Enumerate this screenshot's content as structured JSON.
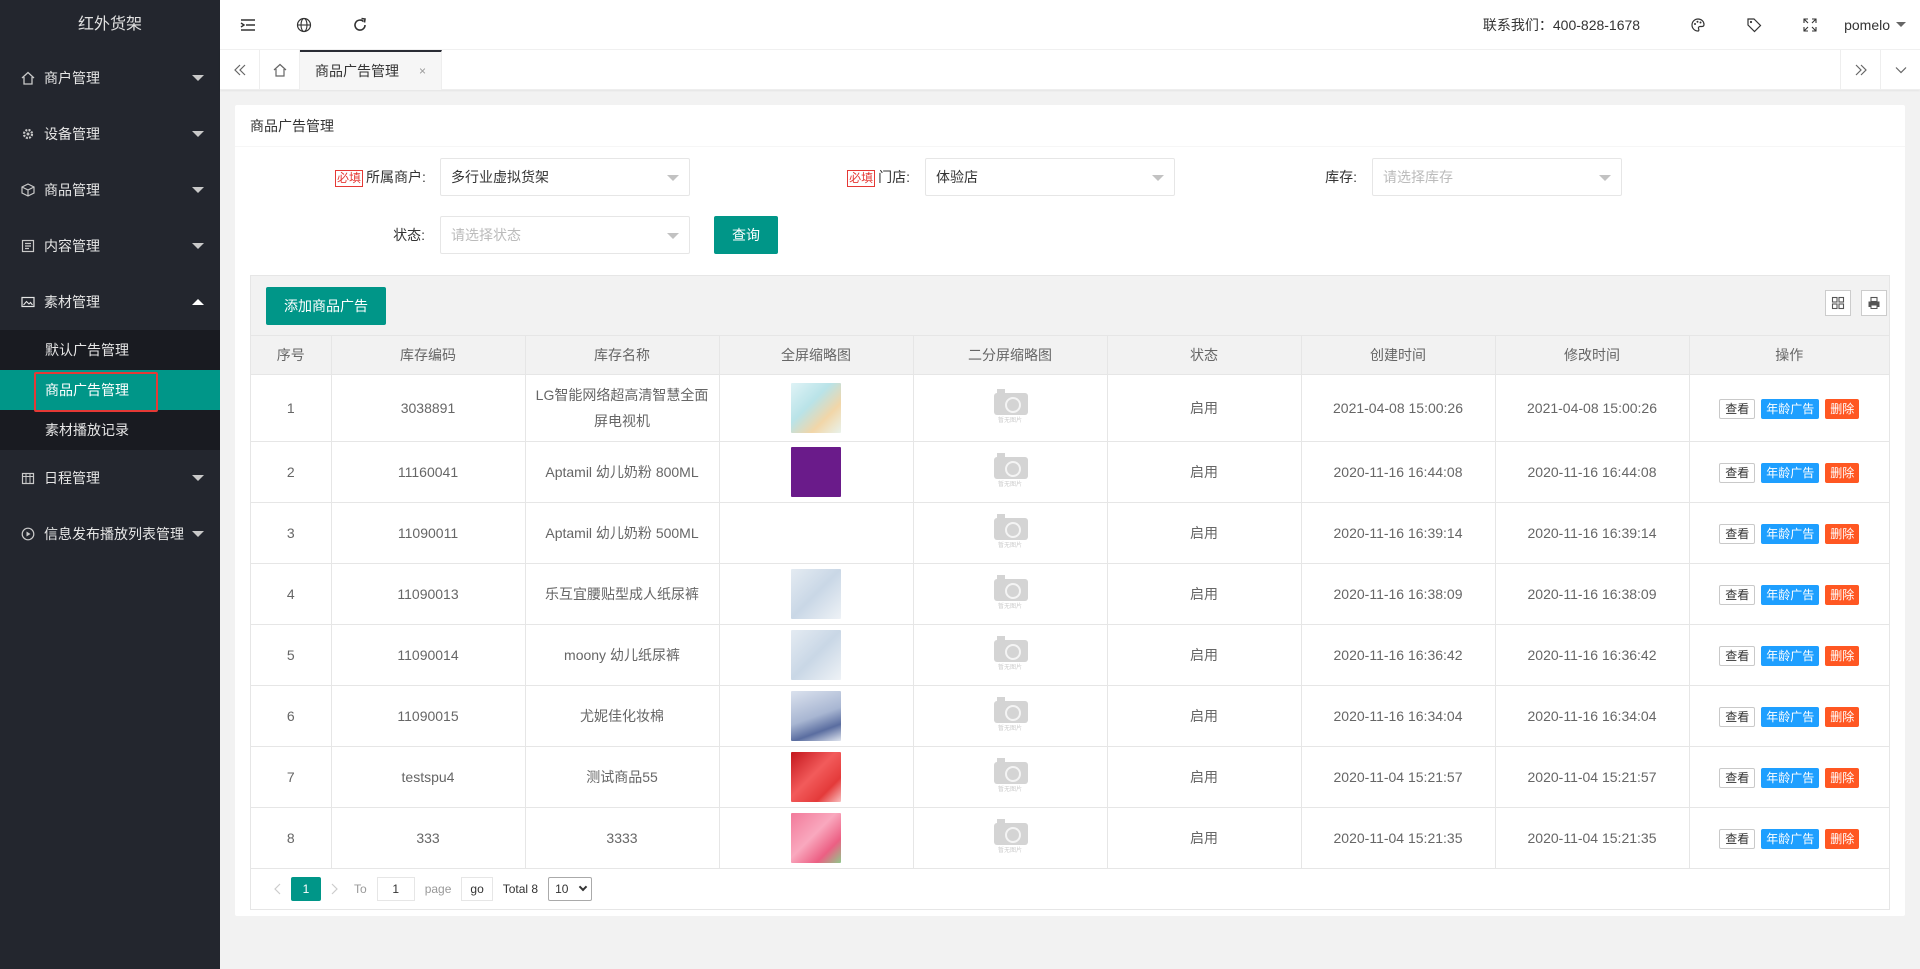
{
  "app": {
    "title": "红外货架"
  },
  "sidebar": {
    "items": [
      {
        "label": "商户管理",
        "icon": "home-icon"
      },
      {
        "label": "设备管理",
        "icon": "gear-icon"
      },
      {
        "label": "商品管理",
        "icon": "cube-icon"
      },
      {
        "label": "内容管理",
        "icon": "content-icon"
      },
      {
        "label": "素材管理",
        "icon": "image-icon",
        "open": true,
        "children": [
          {
            "label": "默认广告管理"
          },
          {
            "label": "商品广告管理",
            "active": true
          },
          {
            "label": "素材播放记录"
          }
        ]
      },
      {
        "label": "日程管理",
        "icon": "calendar-icon"
      },
      {
        "label": "信息发布播放列表管理",
        "icon": "play-icon"
      }
    ]
  },
  "header": {
    "contact": "联系我们：400-828-1678",
    "user": "pomelo"
  },
  "tabs": {
    "active_tab": "商品广告管理",
    "close_glyph": "×"
  },
  "card": {
    "title": "商品广告管理",
    "required_badge": "必填",
    "filters": {
      "merchant": {
        "label": "所属商户:",
        "value": "多行业虚拟货架"
      },
      "store": {
        "label": "门店:",
        "value": "体验店"
      },
      "stock": {
        "label": "库存:",
        "placeholder": "请选择库存"
      },
      "status": {
        "label": "状态:",
        "placeholder": "请选择状态"
      },
      "query_button": "查询"
    },
    "add_button": "添加商品广告",
    "table": {
      "columns": [
        "序号",
        "库存编码",
        "库存名称",
        "全屏缩略图",
        "二分屏缩略图",
        "状态",
        "创建时间",
        "修改时间",
        "操作"
      ],
      "placeholder_text": "暂无图片",
      "actions": {
        "view": "查看",
        "age": "年龄广告",
        "delete": "删除"
      },
      "rows": [
        {
          "no": "1",
          "code": "3038891",
          "name": "LG智能网络超高清智慧全面屏电视机",
          "thumb": "light-green",
          "status": "启用",
          "created": "2021-04-08 15:00:26",
          "modified": "2021-04-08 15:00:26"
        },
        {
          "no": "2",
          "code": "11160041",
          "name": "Aptamil 幼儿奶粉 800ML",
          "thumb": "purple",
          "status": "启用",
          "created": "2020-11-16 16:44:08",
          "modified": "2020-11-16 16:44:08"
        },
        {
          "no": "3",
          "code": "11090011",
          "name": "Aptamil 幼儿奶粉 500ML",
          "thumb": "none",
          "status": "启用",
          "created": "2020-11-16 16:39:14",
          "modified": "2020-11-16 16:39:14"
        },
        {
          "no": "4",
          "code": "11090013",
          "name": "乐互宜腰贴型成人纸尿裤",
          "thumb": "light-blue",
          "status": "启用",
          "created": "2020-11-16 16:38:09",
          "modified": "2020-11-16 16:38:09"
        },
        {
          "no": "5",
          "code": "11090014",
          "name": "moony 幼儿纸尿裤",
          "thumb": "light-blue",
          "status": "启用",
          "created": "2020-11-16 16:36:42",
          "modified": "2020-11-16 16:36:42"
        },
        {
          "no": "6",
          "code": "11090015",
          "name": "尤妮佳化妆棉",
          "thumb": "blue-gray",
          "status": "启用",
          "created": "2020-11-16 16:34:04",
          "modified": "2020-11-16 16:34:04"
        },
        {
          "no": "7",
          "code": "testspu4",
          "name": "测试商品55",
          "thumb": "red",
          "status": "启用",
          "created": "2020-11-04 15:21:57",
          "modified": "2020-11-04 15:21:57"
        },
        {
          "no": "8",
          "code": "333",
          "name": "3333",
          "thumb": "pink",
          "status": "启用",
          "created": "2020-11-04 15:21:35",
          "modified": "2020-11-04 15:21:35"
        }
      ]
    },
    "pagination": {
      "current": "1",
      "to_label": "To",
      "input_value": "1",
      "page_label": "page",
      "go_label": "go",
      "total": "Total 8",
      "page_size": "10"
    }
  },
  "colors": {
    "accent": "#009688",
    "sidebar_bg": "#23262e",
    "age_button": "#1e9fff",
    "delete_button": "#ff5722"
  }
}
